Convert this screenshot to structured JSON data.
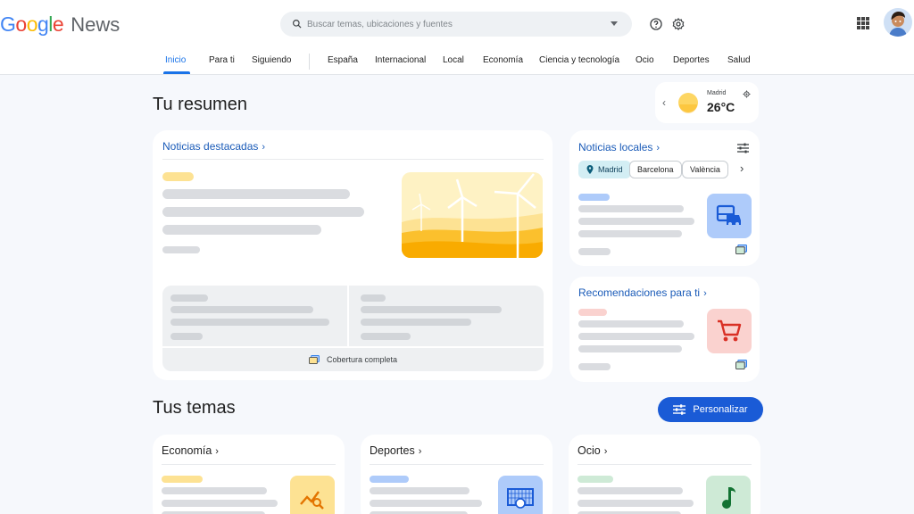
{
  "header": {
    "logo_google": "Google",
    "logo_news": "News",
    "search_placeholder": "Buscar temas, ubicaciones y fuentes",
    "icons": [
      "search-icon",
      "help-icon",
      "settings-icon",
      "apps-icon",
      "avatar"
    ]
  },
  "nav": {
    "items": [
      "Inicio",
      "Para ti",
      "Siguiendo",
      "España",
      "Internacional",
      "Local",
      "Economía",
      "Ciencia y tecnología",
      "Ocio",
      "Deportes",
      "Salud"
    ],
    "active": "Inicio"
  },
  "summary": {
    "title": "Tu resumen",
    "weather": {
      "city": "Madrid",
      "temp": "26°C"
    },
    "featured": {
      "title": "Noticias destacadas",
      "coverage": "Cobertura completa"
    },
    "local": {
      "title": "Noticias locales",
      "chips": [
        "Madrid",
        "Barcelona",
        "València"
      ],
      "selected_chip": "Madrid"
    },
    "recommendations": {
      "title": "Recomendaciones para ti"
    }
  },
  "topics": {
    "title": "Tus temas",
    "customize_label": "Personalizar",
    "cards": [
      "Economía",
      "Deportes",
      "Ocio"
    ]
  },
  "colors": {
    "accent": "#1a73e8",
    "button": "#1a5bd6",
    "skeleton": "#dadce0",
    "yellow": "#fde293",
    "blue_thumb": "#aecbfa",
    "red_thumb": "#fad2cf",
    "green_thumb": "#ceead6"
  }
}
